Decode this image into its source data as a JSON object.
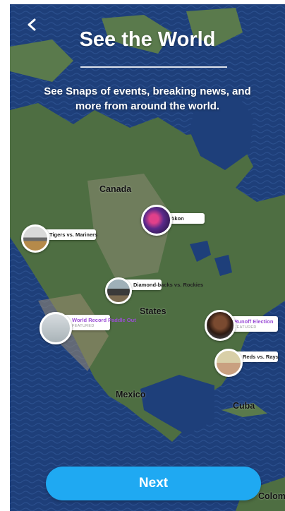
{
  "header": {
    "title": "See the World",
    "subtitle": "See Snaps of events, breaking news, and more from around the world."
  },
  "map_labels": {
    "canada": "Canada",
    "states": "States",
    "mexico": "Mexico",
    "cuba": "Cuba",
    "colombia": "Colomb"
  },
  "pins": [
    {
      "title": "Akon",
      "emoji_icon": "fire-emoji-icon"
    },
    {
      "title": "Tigers vs. Mariners",
      "emoji_icon": "baseball-icon"
    },
    {
      "title": "Diamond-backs vs. Rockies",
      "emoji_icon": "baseball-icon"
    },
    {
      "title": "World Record Paddle Out",
      "tag": "FEATURED"
    },
    {
      "title": "Runoff Election",
      "tag": "FEATURED"
    },
    {
      "title": "Reds vs. Rays",
      "emoji_icon": "baseball-icon"
    }
  ],
  "footer": {
    "next_label": "Next"
  },
  "colors": {
    "accent": "#1fa9f2",
    "ocean": "#1e3f7a",
    "land": "#4a6b3f",
    "featured": "#9b4dd6"
  }
}
